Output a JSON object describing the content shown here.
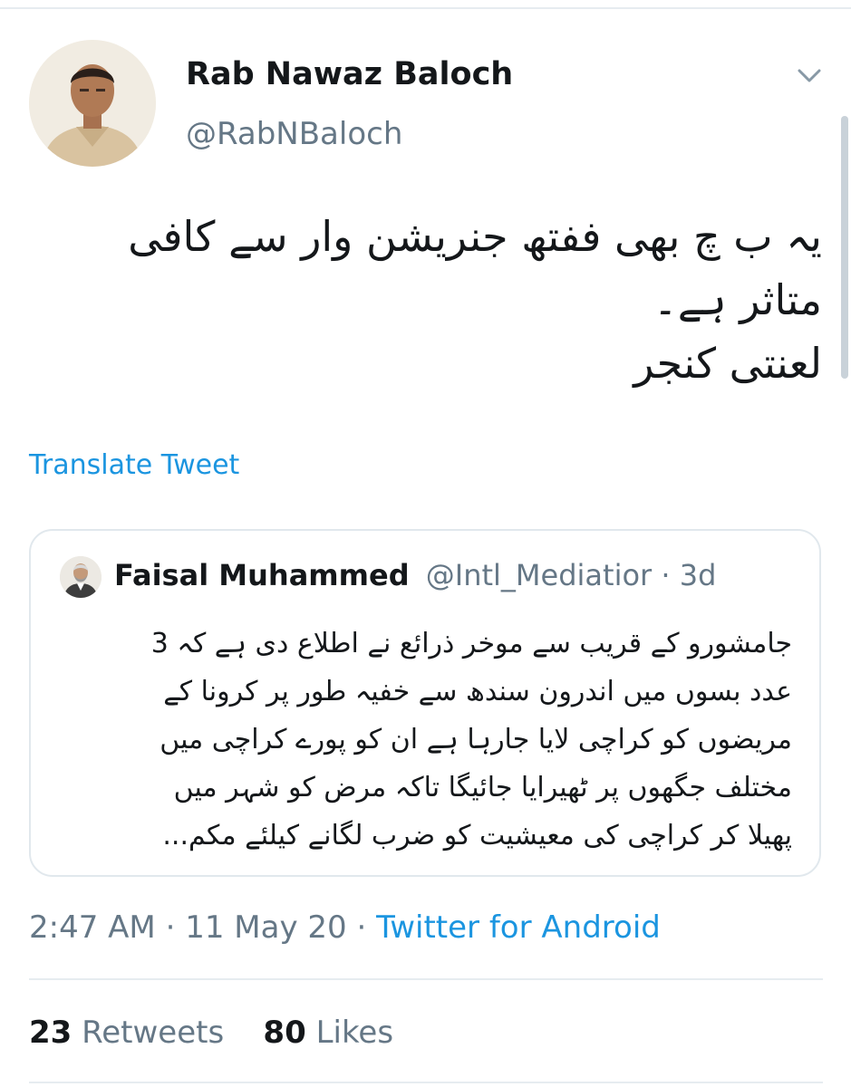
{
  "tweet": {
    "author_name": "Rab Nawaz Baloch",
    "author_handle": "@RabNBaloch",
    "avatar_icon": "profile-photo",
    "menu_icon": "chevron-down-icon",
    "text_lines": [
      "یہ ب چ بھی ففتھ جنریشن وار سے کافی",
      "متاثر ہے۔",
      "لعنتی کنجر"
    ],
    "translate_label": "Translate Tweet"
  },
  "quoted_tweet": {
    "author_name": "Faisal Muhammed",
    "author_handle": "@Intl_Mediatior",
    "separator": "·",
    "time": "3d",
    "text_lines": [
      "جامشورو کے قریب سے موخر ذرائع نے اطلاع دی ہے کہ 3",
      "عدد بسوں میں اندرون سندھ سے خفیہ طور پر کرونا کے",
      "مریضوں کو کراچی لایا جارہا ہے ان کو پورے کراچی میں",
      "مختلف جگھوں پر ٹھیرایا جائیگا تاکہ مرض کو شہر میں",
      "پھیلا کر کراچی کی معیشیت کو ضرب لگانے کیلئے مکم..."
    ]
  },
  "meta": {
    "time": "2:47 AM",
    "separator": "·",
    "date": "11 May 20",
    "source": "Twitter for Android"
  },
  "stats": {
    "retweets_count": "23",
    "retweets_label": "Retweets",
    "likes_count": "80",
    "likes_label": "Likes"
  },
  "colors": {
    "link": "#1b95e0",
    "muted": "#657786",
    "text": "#14171a",
    "border": "#e1e8ed"
  }
}
